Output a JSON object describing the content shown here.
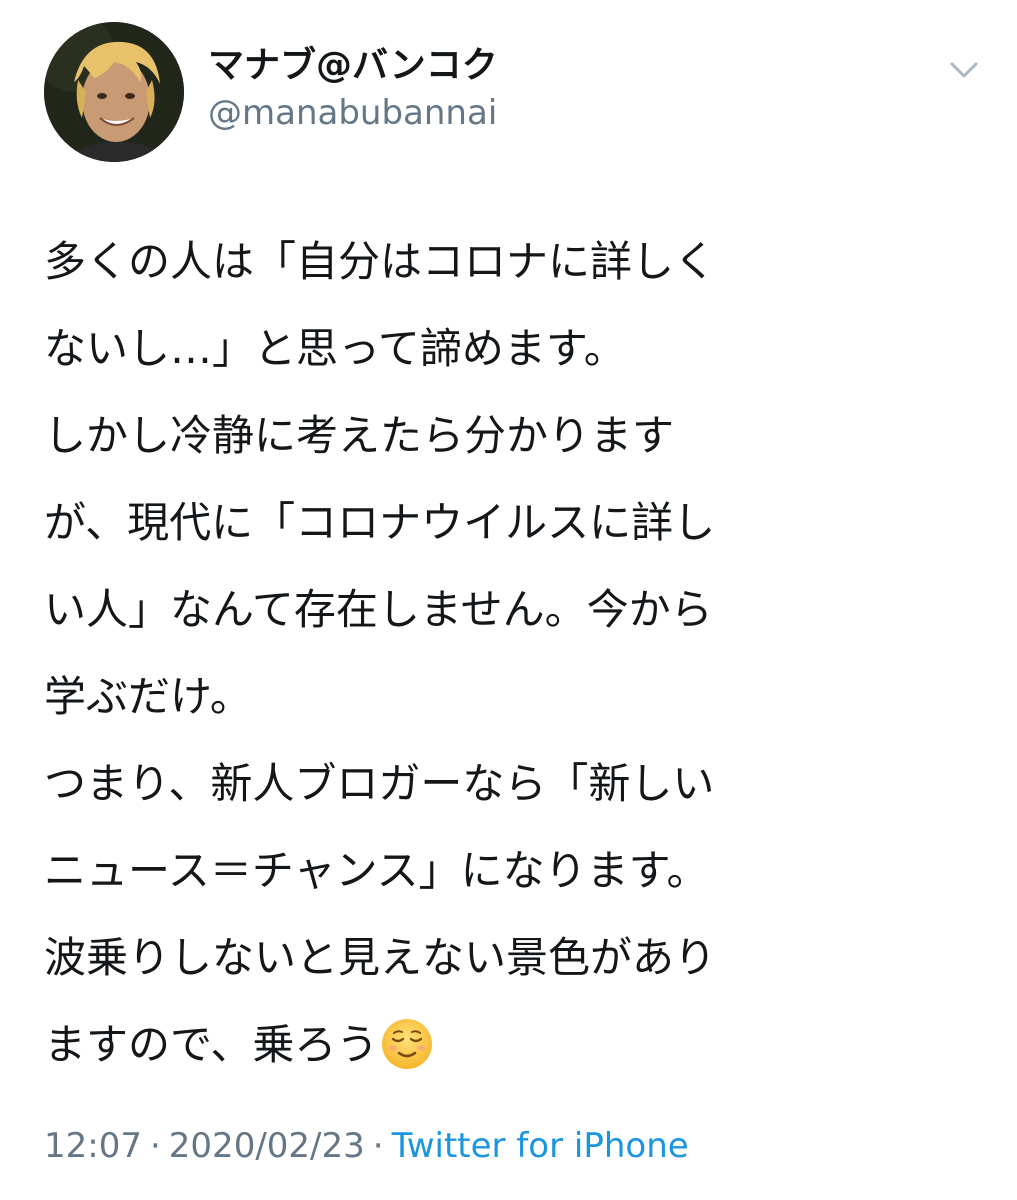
{
  "user": {
    "display_name": "マナブ@バンコク",
    "handle": "@manabubannai"
  },
  "icons": {
    "more": "chevron-down-icon",
    "emoji": "relieved-face-emoji"
  },
  "tweet": {
    "lines": [
      "多くの人は「自分はコロナに詳しく",
      "ないし…」と思って諦めます。",
      "しかし冷静に考えたら分かります",
      "が、現代に「コロナウイルスに詳し",
      "い人」なんて存在しません。今から",
      "学ぶだけ。",
      "つまり、新人ブロガーなら「新しい",
      "ニュース＝チャンス」になります。",
      "波乗りしないと見えない景色があり",
      "ますので、乗ろう"
    ]
  },
  "meta": {
    "time": "12:07",
    "separator": "·",
    "date": "2020/02/23",
    "source": "Twitter for iPhone"
  },
  "colors": {
    "text": "#14171a",
    "secondary": "#657786",
    "link": "#1b95e0"
  }
}
